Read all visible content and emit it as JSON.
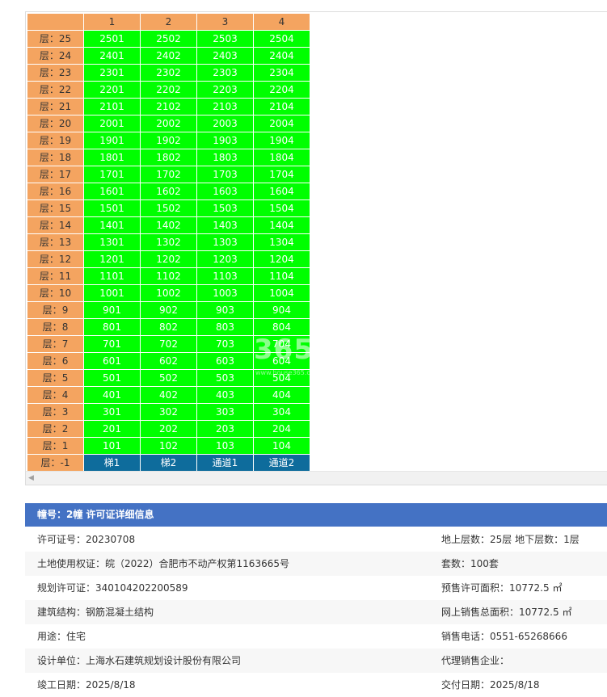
{
  "grid": {
    "headers": [
      "",
      "1",
      "2",
      "3",
      "4"
    ],
    "floor_prefix": "层：",
    "floors": [
      "25",
      "24",
      "23",
      "22",
      "21",
      "20",
      "19",
      "18",
      "17",
      "16",
      "15",
      "14",
      "13",
      "12",
      "11",
      "10",
      "9",
      "8",
      "7",
      "6",
      "5",
      "4",
      "3",
      "2",
      "1"
    ],
    "units": [
      [
        "2501",
        "2502",
        "2503",
        "2504"
      ],
      [
        "2401",
        "2402",
        "2403",
        "2404"
      ],
      [
        "2301",
        "2302",
        "2303",
        "2304"
      ],
      [
        "2201",
        "2202",
        "2203",
        "2204"
      ],
      [
        "2101",
        "2102",
        "2103",
        "2104"
      ],
      [
        "2001",
        "2002",
        "2003",
        "2004"
      ],
      [
        "1901",
        "1902",
        "1903",
        "1904"
      ],
      [
        "1801",
        "1802",
        "1803",
        "1804"
      ],
      [
        "1701",
        "1702",
        "1703",
        "1704"
      ],
      [
        "1601",
        "1602",
        "1603",
        "1604"
      ],
      [
        "1501",
        "1502",
        "1503",
        "1504"
      ],
      [
        "1401",
        "1402",
        "1403",
        "1404"
      ],
      [
        "1301",
        "1302",
        "1303",
        "1304"
      ],
      [
        "1201",
        "1202",
        "1203",
        "1204"
      ],
      [
        "1101",
        "1102",
        "1103",
        "1104"
      ],
      [
        "1001",
        "1002",
        "1003",
        "1004"
      ],
      [
        "901",
        "902",
        "903",
        "904"
      ],
      [
        "801",
        "802",
        "803",
        "804"
      ],
      [
        "701",
        "702",
        "703",
        "704"
      ],
      [
        "601",
        "602",
        "603",
        "604"
      ],
      [
        "501",
        "502",
        "503",
        "504"
      ],
      [
        "401",
        "402",
        "403",
        "404"
      ],
      [
        "301",
        "302",
        "303",
        "304"
      ],
      [
        "201",
        "202",
        "203",
        "204"
      ],
      [
        "101",
        "102",
        "103",
        "104"
      ]
    ],
    "basement_label": "层：-1",
    "basement_cells": [
      "梯1",
      "梯2",
      "通道1",
      "通道2"
    ]
  },
  "colors": {
    "header_bg": "#f4a460",
    "unit_bg": "#00ff00",
    "basement_bg": "#0e6c9c",
    "info_header_bg": "#4472c4"
  },
  "watermark": {
    "big": "365",
    "small": "www.house365.com"
  },
  "info": {
    "title": "幢号：2幢 许可证详细信息",
    "rows": [
      {
        "left": "许可证号：20230708",
        "right": "地上层数：25层  地下层数：1层"
      },
      {
        "left": "土地使用权证：皖（2022）合肥市不动产权第1163665号",
        "right": "套数：100套"
      },
      {
        "left": "规划许可证：340104202200589",
        "right": "预售许可面积：10772.5 ㎡"
      },
      {
        "left": "建筑结构：钢筋混凝土结构",
        "right": "网上销售总面积：10772.5 ㎡"
      },
      {
        "left": "用途：住宅",
        "right": "销售电话：0551-65268666"
      },
      {
        "left": "设计单位：上海水石建筑规划设计股份有限公司",
        "right": "代理销售企业："
      },
      {
        "left": "竣工日期：2025/8/18",
        "right": "交付日期：2025/8/18"
      }
    ]
  }
}
